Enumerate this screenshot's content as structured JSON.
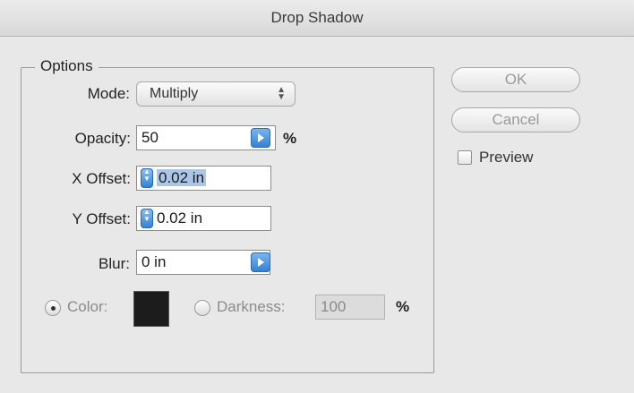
{
  "window": {
    "title": "Drop Shadow"
  },
  "options": {
    "legend": "Options",
    "mode": {
      "label": "Mode:",
      "value": "Multiply"
    },
    "opacity": {
      "label": "Opacity:",
      "value": "50",
      "unit": "%"
    },
    "x_offset": {
      "label": "X Offset:",
      "value": "0.02 in"
    },
    "y_offset": {
      "label": "Y Offset:",
      "value": "0.02 in"
    },
    "blur": {
      "label": "Blur:",
      "value": "0 in"
    },
    "color": {
      "label": "Color:",
      "selected": true,
      "swatch": "#1c1c1c"
    },
    "darkness": {
      "label": "Darkness:",
      "value": "100",
      "unit": "%",
      "selected": false
    }
  },
  "buttons": {
    "ok": "OK",
    "cancel": "Cancel"
  },
  "preview": {
    "label": "Preview",
    "checked": false
  },
  "colors": {
    "selection": "#a9c6e8",
    "accent": "#2f7fd5"
  }
}
